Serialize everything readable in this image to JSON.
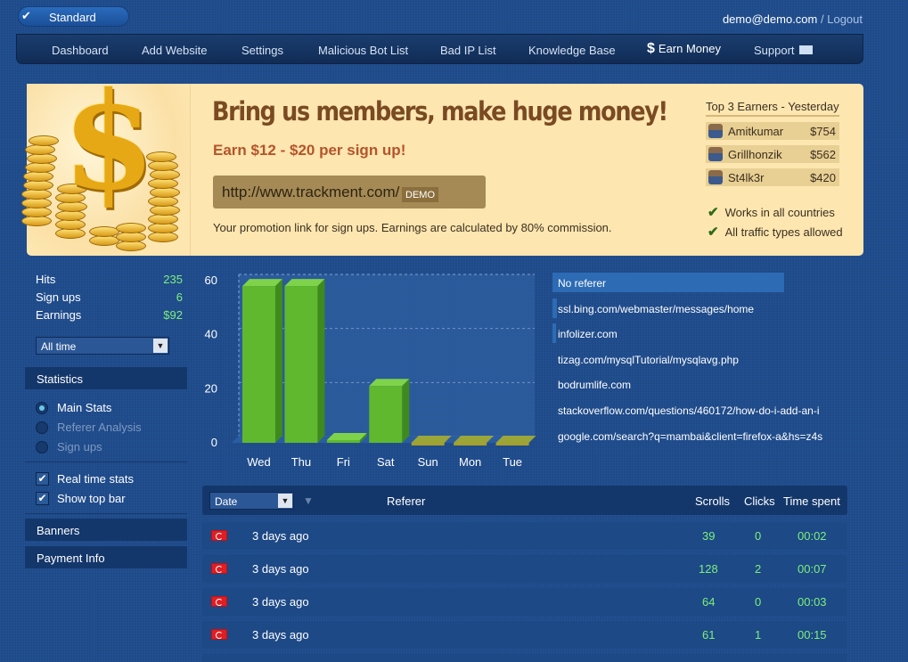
{
  "topbar": {
    "plan_label": "Standard",
    "account_email": "demo@demo.com",
    "separator": "/",
    "logout_label": "Logout"
  },
  "nav": {
    "items": [
      {
        "label": "Dashboard"
      },
      {
        "label": "Add Website"
      },
      {
        "label": "Settings"
      },
      {
        "label": "Malicious Bot List"
      },
      {
        "label": "Bad IP List"
      },
      {
        "label": "Knowledge Base"
      },
      {
        "label": "Earn Money",
        "icon": "dollar-icon",
        "active": true
      },
      {
        "label": "Support",
        "icon": "mail-icon"
      }
    ]
  },
  "promo": {
    "headline": "Bring us members, make huge money!",
    "subline": "Earn $12 - $20 per sign up!",
    "url": "http://www.trackment.com/",
    "url_suffix": "DEMO",
    "note": "Your promotion link for sign ups. Earnings are calculated by 80% commission.",
    "top3_title": "Top 3 Earners - Yesterday",
    "earners": [
      {
        "name": "Amitkumar",
        "amount": "$754"
      },
      {
        "name": "Grillhonzik",
        "amount": "$562"
      },
      {
        "name": "St4lk3r",
        "amount": "$420"
      }
    ],
    "features": [
      "Works in all countries",
      "All traffic types allowed"
    ]
  },
  "sidebar": {
    "stats": [
      {
        "label": "Hits",
        "value": "235"
      },
      {
        "label": "Sign ups",
        "value": "6"
      },
      {
        "label": "Earnings",
        "value": "$92"
      }
    ],
    "range_select": "All time",
    "statistics_header": "Statistics",
    "radios": [
      {
        "label": "Main Stats",
        "selected": true
      },
      {
        "label": "Referer Analysis",
        "selected": false
      },
      {
        "label": "Sign ups",
        "selected": false
      }
    ],
    "checkboxes": [
      {
        "label": "Real time stats",
        "checked": true
      },
      {
        "label": "Show top bar",
        "checked": true
      }
    ],
    "banners_header": "Banners",
    "payment_header": "Payment Info"
  },
  "chart_data": {
    "type": "bar",
    "categories": [
      "Wed",
      "Thu",
      "Fri",
      "Sat",
      "Sun",
      "Mon",
      "Tue"
    ],
    "values": [
      58,
      58,
      1,
      21,
      0,
      0,
      0
    ],
    "ylim": [
      0,
      60
    ],
    "yticks": [
      0,
      20,
      40,
      60
    ],
    "grid": true,
    "bar_color": "#5fb82e"
  },
  "referers": [
    {
      "label": "No referer",
      "weight": 1.0
    },
    {
      "label": "ssl.bing.com/webmaster/messages/home",
      "weight": 0.02
    },
    {
      "label": "infolizer.com",
      "weight": 0.01
    },
    {
      "label": "tizag.com/mysqlTutorial/mysqlavg.php",
      "weight": 0.0
    },
    {
      "label": "bodrumlife.com",
      "weight": 0.0
    },
    {
      "label": "stackoverflow.com/questions/460172/how-do-i-add-an-i",
      "weight": 0.0
    },
    {
      "label": "google.com/search?q=mambai&client=firefox-a&hs=z4s",
      "weight": 0.0
    }
  ],
  "table": {
    "date_select": "Date",
    "headers": {
      "referer": "Referer",
      "scrolls": "Scrolls",
      "clicks": "Clicks",
      "time": "Time spent"
    },
    "rows": [
      {
        "when": "3 days ago",
        "scrolls": "39",
        "clicks": "0",
        "time": "00:02"
      },
      {
        "when": "3 days ago",
        "scrolls": "128",
        "clicks": "2",
        "time": "00:07"
      },
      {
        "when": "3 days ago",
        "scrolls": "64",
        "clicks": "0",
        "time": "00:03"
      },
      {
        "when": "3 days ago",
        "scrolls": "61",
        "clicks": "1",
        "time": "00:15"
      }
    ]
  }
}
